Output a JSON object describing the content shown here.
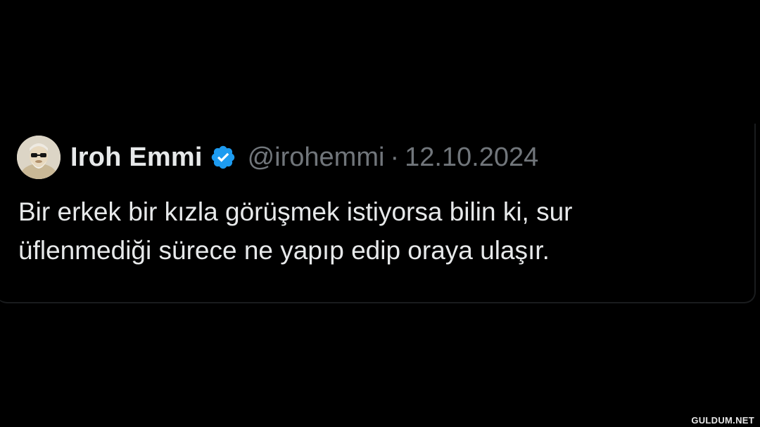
{
  "tweet": {
    "display_name": "Iroh Emmi",
    "verified": true,
    "verified_icon": "verified-badge-icon",
    "handle": "@irohemmi",
    "separator": "·",
    "date": "12.10.2024",
    "text_lines": [
      "Bir erkek bir kızla görüşmek istiyorsa bilin ki, sur",
      "üflenmediği sürece ne yapıp edip oraya ulaşır."
    ]
  },
  "watermark": "GULDUM.NET",
  "colors": {
    "background": "#000000",
    "primary_text": "#e7e9ea",
    "secondary_text": "#71767b",
    "verified_blue": "#1d9bf0",
    "divider": "#1a1c1e"
  }
}
